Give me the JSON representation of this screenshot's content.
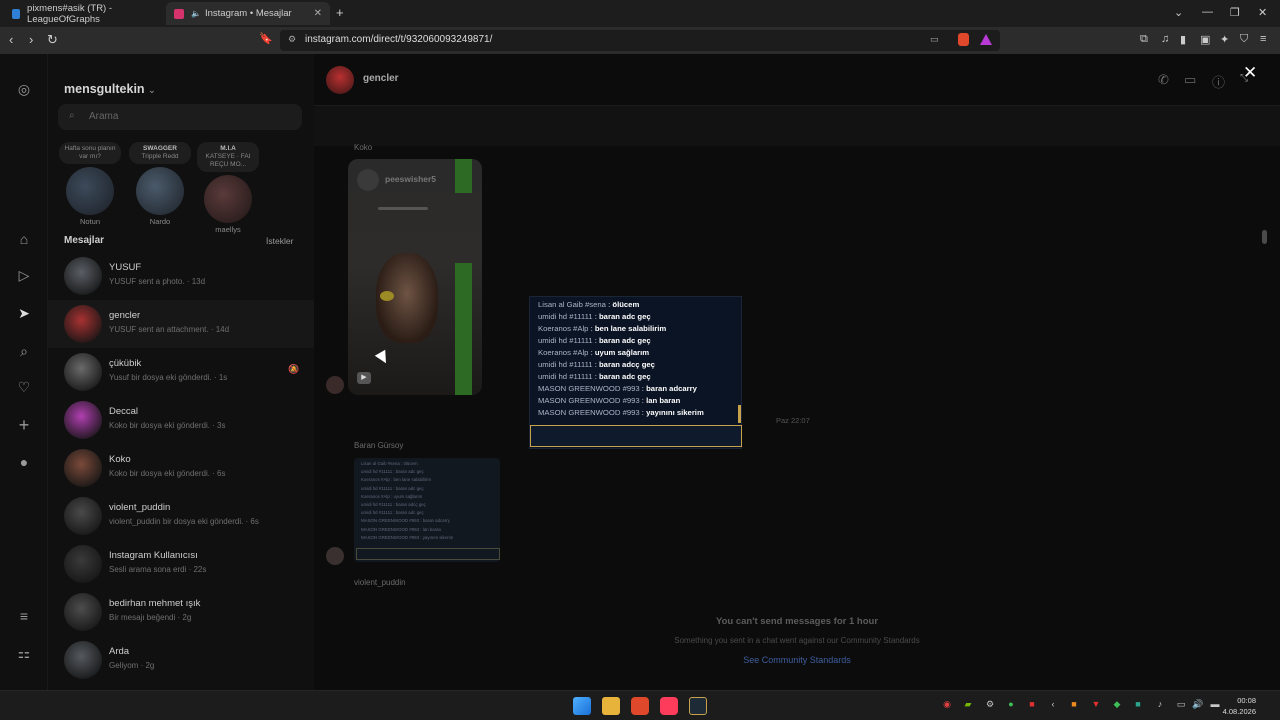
{
  "browser": {
    "tabs": [
      {
        "title": "pixmens#asik (TR) - LeagueOfGraphs",
        "active": false,
        "favicon_color": "#2f7fd6"
      },
      {
        "title": "Instagram • Mesajlar",
        "active": true,
        "favicon_color": "#d6336c"
      }
    ],
    "url": "instagram.com/direct/t/932060093249871/"
  },
  "sidebar": {
    "username": "mensgultekin",
    "search_placeholder": "Arama",
    "notes": [
      {
        "text": "Hafta sonu planın var mı?",
        "title": "",
        "sub": "",
        "name": "Notun"
      },
      {
        "text": "",
        "title": "SWAGGER",
        "sub": "Tripple Redd",
        "name": "Nardo"
      },
      {
        "text": "",
        "title": "M.I.A",
        "sub": "KATSEYE · FAI REÇU MO...",
        "name": "maellys"
      }
    ],
    "messages_header": "Mesajlar",
    "requests_label": "İstekler",
    "conversations": [
      {
        "name": "YUSUF",
        "sub": "YUSUF sent a photo. · 13d",
        "color": "#5a5f66",
        "muted": false,
        "selected": false
      },
      {
        "name": "gencler",
        "sub": "YUSUF sent an attachment. · 14d",
        "color": "#a83232",
        "muted": false,
        "selected": true
      },
      {
        "name": "çükübik",
        "sub": "Yusuf bir dosya eki gönderdi. · 1s",
        "color": "#6a6a6a",
        "muted": true,
        "selected": false
      },
      {
        "name": "Deccal",
        "sub": "Koko bir dosya eki gönderdi. · 3s",
        "color": "#b03fb0",
        "muted": false,
        "selected": false
      },
      {
        "name": "Koko",
        "sub": "Koko bir dosya eki gönderdi. · 6s",
        "color": "#7a4a3a",
        "muted": false,
        "selected": false
      },
      {
        "name": "violent_puddin",
        "sub": "violent_puddin bir dosya eki gönderdi. · 6s",
        "color": "#4a4a4a",
        "muted": false,
        "selected": false
      },
      {
        "name": "Instagram Kullanıcısı",
        "sub": "Sesli arama sona erdi · 22s",
        "color": "#3a3a3a",
        "muted": false,
        "selected": false
      },
      {
        "name": "bedirhan mehmet ışık",
        "sub": "Bir mesajı beğendi · 2g",
        "color": "#4d4d4d",
        "muted": false,
        "selected": false
      },
      {
        "name": "Arda",
        "sub": "Geliyom · 2g",
        "color": "#555a60",
        "muted": false,
        "selected": false
      }
    ]
  },
  "chat": {
    "title": "gencler",
    "sender_top": "Koko",
    "video_author": "peeswisher5",
    "sender_mid": "Baran Gürsoy",
    "sender_bottom": "violent_puddin",
    "timestamp": "Paz 22:07",
    "restriction_title": "You can't send messages for 1 hour",
    "restriction_sub": "Something you sent in a chat went against our Community Standards",
    "restriction_link": "See Community Standards"
  },
  "game_chat": [
    {
      "user": "Lisan al Gaib #sena",
      "msg": "ölücem"
    },
    {
      "user": "umidi hd #11111",
      "msg": "baran adc geç"
    },
    {
      "user": "Koeranos #Alp",
      "msg": "ben lane salabilirim"
    },
    {
      "user": "umidi hd #11111",
      "msg": "baran adc geç"
    },
    {
      "user": "Koeranos #Alp",
      "msg": "uyum sağlarım"
    },
    {
      "user": "umidi hd #11111",
      "msg": "baran adcç geç"
    },
    {
      "user": "umidi hd #11111",
      "msg": "baran adc geç"
    },
    {
      "user": "MASON GREENWOOD #993",
      "msg": "baran adcarry"
    },
    {
      "user": "MASON GREENWOOD #993",
      "msg": "lan baran"
    },
    {
      "user": "MASON GREENWOOD #993",
      "msg": "yayınını sikerim"
    }
  ],
  "thumb_chat": [
    "Lisan al Gaib #sena : ölücem",
    "umidi hd #11111 : baran adc geç",
    "Koeranos #Alp : ben lane salabilirim",
    "umidi hd #11111 : baran adc geç",
    "Koeranos #Alp : uyum sağlarım",
    "umidi hd #11111 : baran adcç geç",
    "umidi hd #11111 : baran adc geç",
    "MASON GREENWOOD #993 : baran adcarry",
    "MASON GREENWOOD #993 : lan baran",
    "MASON GREENWOOD #993 : yayınını sikerim"
  ],
  "taskbar": {
    "time": "00:08",
    "date": "4.08.2026"
  }
}
